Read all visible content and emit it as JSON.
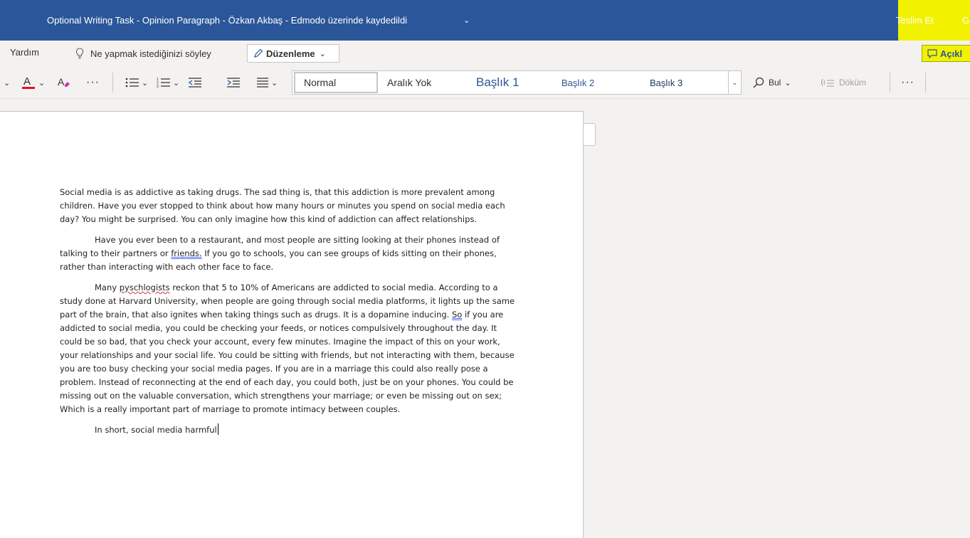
{
  "titlebar": {
    "title": "Optional Writing Task - Opinion Paragraph - Özkan Akbaş  -  Edmodo üzerinde kaydedildi",
    "submit_label": "Teslim Et",
    "more_label": "G",
    "colors": {
      "background": "#2b579a",
      "highlight": "#f2f200"
    }
  },
  "menubar": {
    "help_tab": "Yardım",
    "tellme_placeholder": "Ne yapmak istediğinizi söyley",
    "editing_label": "Düzenleme",
    "comments_label": "Açıkl"
  },
  "ribbon": {
    "styles": {
      "normal": "Normal",
      "no_spacing": "Aralık Yok",
      "heading1": "Başlık 1",
      "heading2": "Başlık 2",
      "heading3": "Başlık 3"
    },
    "find_label": "Bul",
    "dictate_label": "Döküm",
    "font_color": "#e81123"
  },
  "document": {
    "p1": "Social media is as addictive as taking drugs. The sad thing is, that this addiction is more prevalent among children. Have you ever stopped to think about how many hours or minutes you spend on social media each day? You might be surprised. You can only imagine how this kind of addiction can affect relationships.",
    "p2": {
      "a": "Have you ever been to a restaurant, and most people are sitting looking at their phones instead of talking to their partners or ",
      "b": "friends.",
      "c": " If you go to schools, you can see groups of kids sitting on their phones, rather than interacting with each other face to face."
    },
    "p3": {
      "a": "Many ",
      "b": "pyschlogists",
      "c": " reckon that 5 to 10% of Americans are addicted to social media. According to a study done at Harvard University, when people are going through social media platforms, it lights up the same part of the brain, that also ignites when taking things such as drugs. It is a dopamine inducing. ",
      "d": "So",
      "e": " if you are addicted to social media, you could be checking your feeds, or notices compulsively throughout the day. It could be so bad, that you check your account, every few minutes. Imagine the impact of this on your work, your relationships and your social life. You could be sitting with friends, but not interacting with them, because you are too busy checking your social media pages. If you are in a marriage this could also really pose a problem. Instead of reconnecting at the end of each day, you could both, just be on your phones. You could be missing out on the valuable conversation, which strengthens your marriage; or even be missing out on sex; Which is a really important part of marriage to promote intimacy between couples."
    },
    "p4": "In short, social media harmful"
  }
}
